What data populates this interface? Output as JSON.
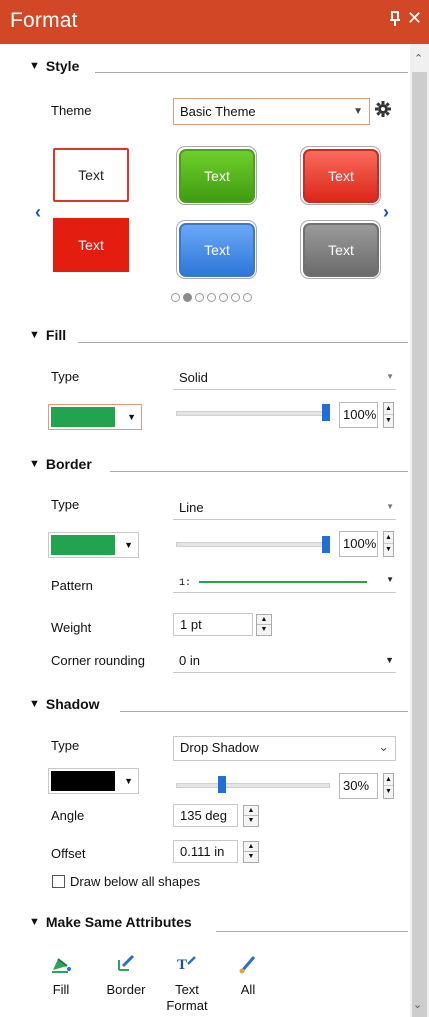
{
  "panel": {
    "title": "Format",
    "pin_glyph": "❑",
    "close_glyph": "✕"
  },
  "style": {
    "heading": "Style",
    "theme_label": "Theme",
    "theme_value": "Basic Theme",
    "tile_text": "Text",
    "pages": 7,
    "active_page": 1
  },
  "fill": {
    "heading": "Fill",
    "type_label": "Type",
    "type_value": "Solid",
    "color": "#22a350",
    "transparency_value": "100%"
  },
  "border": {
    "heading": "Border",
    "type_label": "Type",
    "type_value": "Line",
    "color": "#22a350",
    "transparency_value": "100%",
    "pattern_label": "Pattern",
    "pattern_value": "1:",
    "weight_label": "Weight",
    "weight_value": "1 pt",
    "corner_label": "Corner rounding",
    "corner_value": "0 in"
  },
  "shadow": {
    "heading": "Shadow",
    "type_label": "Type",
    "type_value": "Drop Shadow",
    "color": "#000000",
    "transparency_value": "30%",
    "transparency_fraction": 0.3,
    "angle_label": "Angle",
    "angle_value": "135 deg",
    "offset_label": "Offset",
    "offset_value": "0.111 in",
    "below_label": "Draw below all shapes"
  },
  "same": {
    "heading": "Make Same Attributes",
    "fill_label": "Fill",
    "border_label": "Border",
    "text_format_label": "Text Format",
    "all_label": "All"
  },
  "colors": {
    "accent": "#d24726",
    "slider": "#1f6fd6",
    "arrow": "#1a56b8"
  }
}
